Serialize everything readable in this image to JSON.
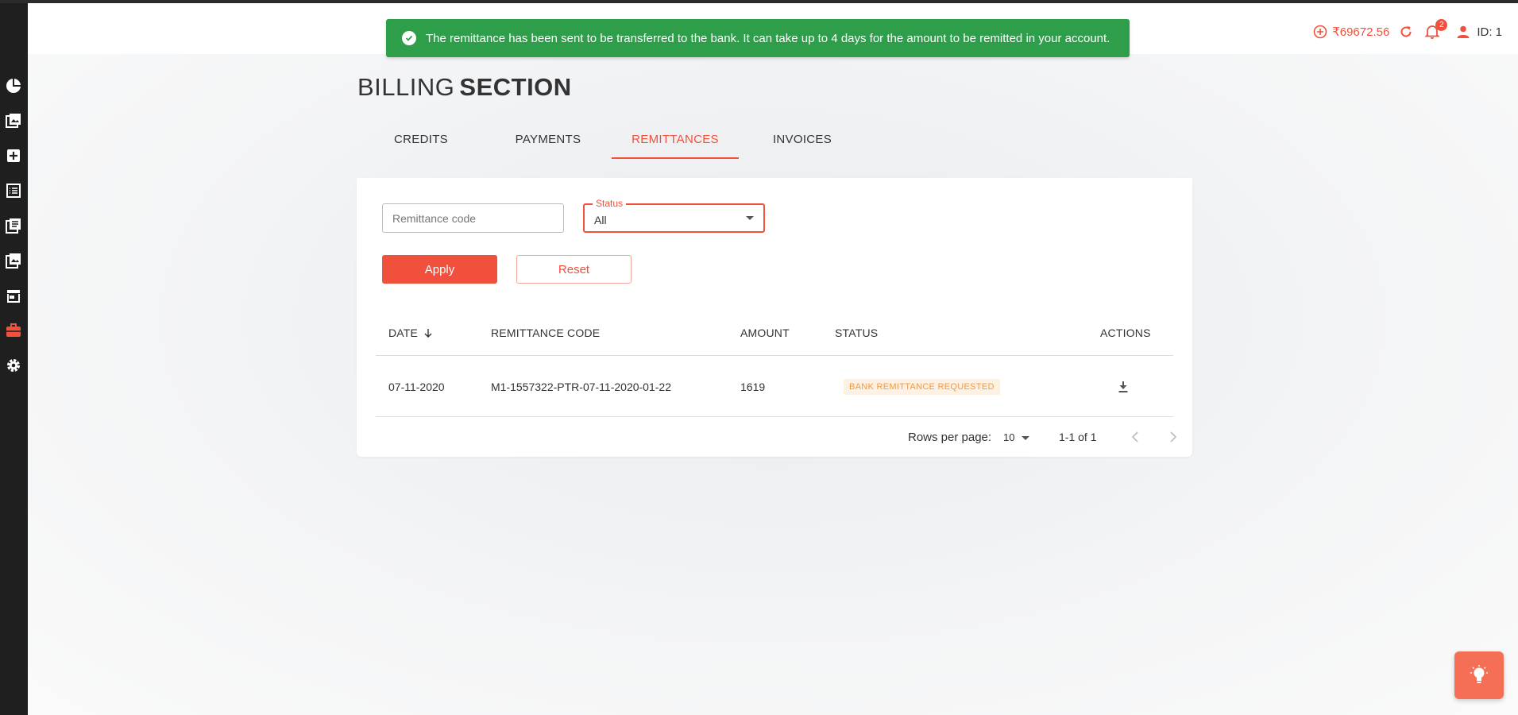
{
  "toast": {
    "message": "The remittance has been sent to be transferred to the bank. It can take up to 4 days for the amount to be remitted in your account."
  },
  "header": {
    "credit_amount": "₹69672.56",
    "notification_count": "2",
    "user_id": "ID: 1"
  },
  "sidebar": {
    "items": [
      {
        "icon": "dashboard-pie-icon"
      },
      {
        "icon": "images-icon"
      },
      {
        "icon": "add-box-icon"
      },
      {
        "icon": "list-icon"
      },
      {
        "icon": "library-books-icon"
      },
      {
        "icon": "photo-library-icon"
      },
      {
        "icon": "store-icon"
      },
      {
        "icon": "briefcase-icon",
        "active": true
      },
      {
        "icon": "settings-gear-icon"
      }
    ]
  },
  "page": {
    "title_light": "BILLING",
    "title_bold": "SECTION"
  },
  "tabs": [
    {
      "label": "CREDITS"
    },
    {
      "label": "PAYMENTS"
    },
    {
      "label": "REMITTANCES",
      "active": true
    },
    {
      "label": "INVOICES"
    }
  ],
  "filters": {
    "code_placeholder": "Remittance code",
    "status_label": "Status",
    "status_value": "All",
    "apply_label": "Apply",
    "reset_label": "Reset"
  },
  "table": {
    "columns": [
      "DATE",
      "REMITTANCE CODE",
      "AMOUNT",
      "STATUS",
      "ACTIONS"
    ],
    "rows": [
      {
        "date": "07-11-2020",
        "code": "M1-1557322-PTR-07-11-2020-01-22",
        "amount": "1619",
        "status": "BANK REMITTANCE REQUESTED"
      }
    ]
  },
  "pagination": {
    "rows_per_page_label": "Rows per page:",
    "rows_per_page_value": "10",
    "range": "1-1 of 1"
  },
  "colors": {
    "accent": "#f0503c",
    "toast": "#2e9e4a",
    "status_text": "#f39a3d",
    "sidebar": "#1f1f1f"
  }
}
